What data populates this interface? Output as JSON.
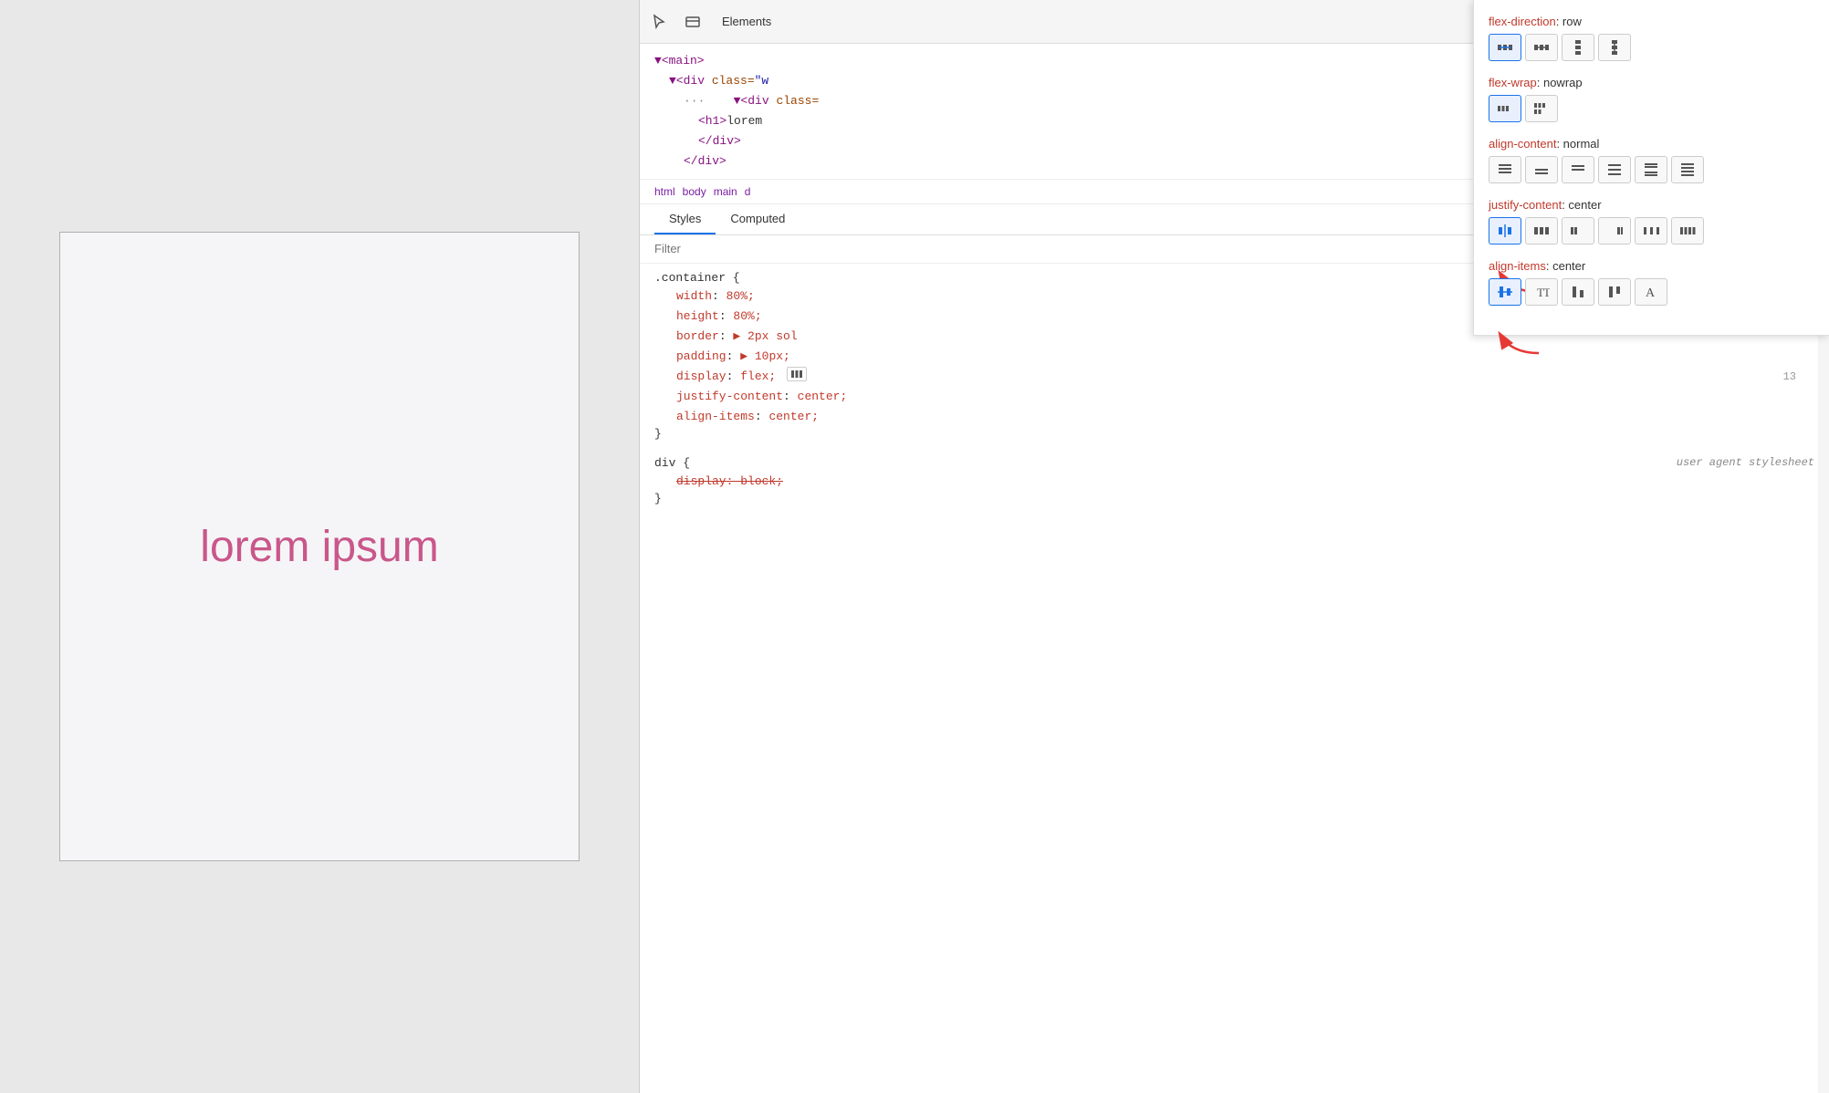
{
  "preview": {
    "text": "lorem ipsum"
  },
  "devtools": {
    "tabs": [
      "Elements"
    ],
    "icons": [
      "cursor",
      "box"
    ],
    "dom": {
      "lines": [
        {
          "indent": 0,
          "content": "▼<main>"
        },
        {
          "indent": 1,
          "content": "▼<div class=\"w"
        },
        {
          "indent": 2,
          "dots": "···",
          "content": "▼<div class="
        },
        {
          "indent": 3,
          "content": "<h1>lorem"
        },
        {
          "indent": 3,
          "content": "</div>"
        },
        {
          "indent": 2,
          "content": "</div>"
        }
      ]
    },
    "breadcrumb": {
      "items": [
        "html",
        "body",
        "main",
        "d"
      ]
    },
    "stylesTabs": {
      "active": "Styles",
      "tabs": [
        "Styles",
        "Computed"
      ]
    },
    "filter": {
      "placeholder": "Filter",
      "value": ""
    },
    "cssRules": {
      "container": {
        "selector": ".container {",
        "properties": [
          {
            "name": "width",
            "value": "80%;"
          },
          {
            "name": "height",
            "value": "80%;"
          },
          {
            "name": "border",
            "value": "▶ 2px sol"
          },
          {
            "name": "padding",
            "value": "▶ 10px;"
          },
          {
            "name": "display",
            "value": "flex;"
          },
          {
            "name": "justify-content",
            "value": "center;"
          },
          {
            "name": "align-items",
            "value": "center;"
          }
        ],
        "close": "}"
      },
      "div": {
        "selector": "div {",
        "comment": "user agent stylesheet",
        "properties": [
          {
            "name": "display: block;",
            "strikethrough": true
          }
        ],
        "close": "}"
      }
    }
  },
  "flexPanel": {
    "properties": [
      {
        "name": "flex-direction",
        "value": "row",
        "buttons": [
          {
            "icon": "row",
            "active": true,
            "title": "row"
          },
          {
            "icon": "row-reverse",
            "active": false,
            "title": "row-reverse"
          },
          {
            "icon": "column",
            "active": false,
            "title": "column"
          },
          {
            "icon": "column-reverse",
            "active": false,
            "title": "column-reverse"
          }
        ]
      },
      {
        "name": "flex-wrap",
        "value": "nowrap",
        "buttons": [
          {
            "icon": "nowrap",
            "active": true,
            "title": "nowrap"
          },
          {
            "icon": "wrap",
            "active": false,
            "title": "wrap"
          }
        ]
      },
      {
        "name": "align-content",
        "value": "normal",
        "buttons": [
          {
            "icon": "ac1",
            "active": false
          },
          {
            "icon": "ac2",
            "active": false
          },
          {
            "icon": "ac3",
            "active": false
          },
          {
            "icon": "ac4",
            "active": false
          },
          {
            "icon": "ac5",
            "active": false
          },
          {
            "icon": "ac6",
            "active": false
          }
        ]
      },
      {
        "name": "justify-content",
        "value": "center",
        "buttons": [
          {
            "icon": "jc1",
            "active": true
          },
          {
            "icon": "jc2",
            "active": false
          },
          {
            "icon": "jc3",
            "active": false
          },
          {
            "icon": "jc4",
            "active": false
          },
          {
            "icon": "jc5",
            "active": false
          },
          {
            "icon": "jc6",
            "active": false
          }
        ]
      },
      {
        "name": "align-items",
        "value": "center",
        "buttons": [
          {
            "icon": "ai1",
            "active": true
          },
          {
            "icon": "ai2",
            "active": false
          },
          {
            "icon": "ai3",
            "active": false
          },
          {
            "icon": "ai4",
            "active": false
          },
          {
            "icon": "ai5",
            "active": false
          }
        ]
      }
    ],
    "closeButton": "×"
  }
}
